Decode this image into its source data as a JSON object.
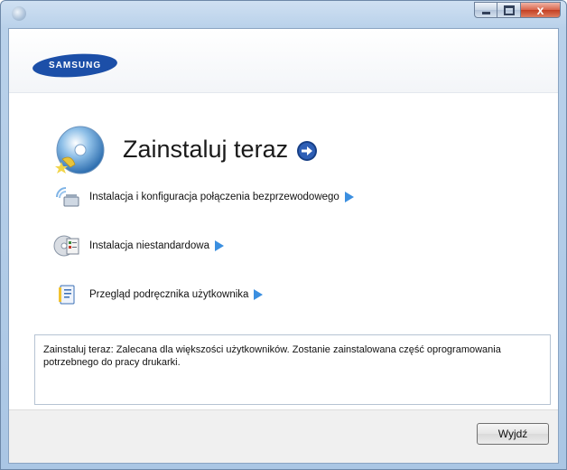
{
  "window": {
    "controls": {
      "minimize_icon": "minimize-icon",
      "maximize_icon": "maximize-icon",
      "close_icon": "close-icon",
      "close_glyph": "x"
    }
  },
  "brand": {
    "logo_text": "SAMSUNG",
    "color": "#1c4fa8"
  },
  "hero": {
    "title": "Zainstaluj teraz"
  },
  "menu": {
    "items": [
      {
        "label": "Instalacja i konfiguracja połączenia bezprzewodowego",
        "icon": "wireless-icon"
      },
      {
        "label": "Instalacja niestandardowa",
        "icon": "custom-install-icon"
      },
      {
        "label": "Przegląd podręcznika użytkownika",
        "icon": "user-guide-icon"
      }
    ]
  },
  "description": {
    "text": "Zainstaluj teraz: Zalecana dla większości użytkowników. Zostanie zainstalowana część oprogramowania potrzebnego do pracy drukarki."
  },
  "footer": {
    "exit_label": "Wyjdź"
  },
  "colors": {
    "accent": "#2a7fd4",
    "arrow": "#3b8fe0"
  }
}
